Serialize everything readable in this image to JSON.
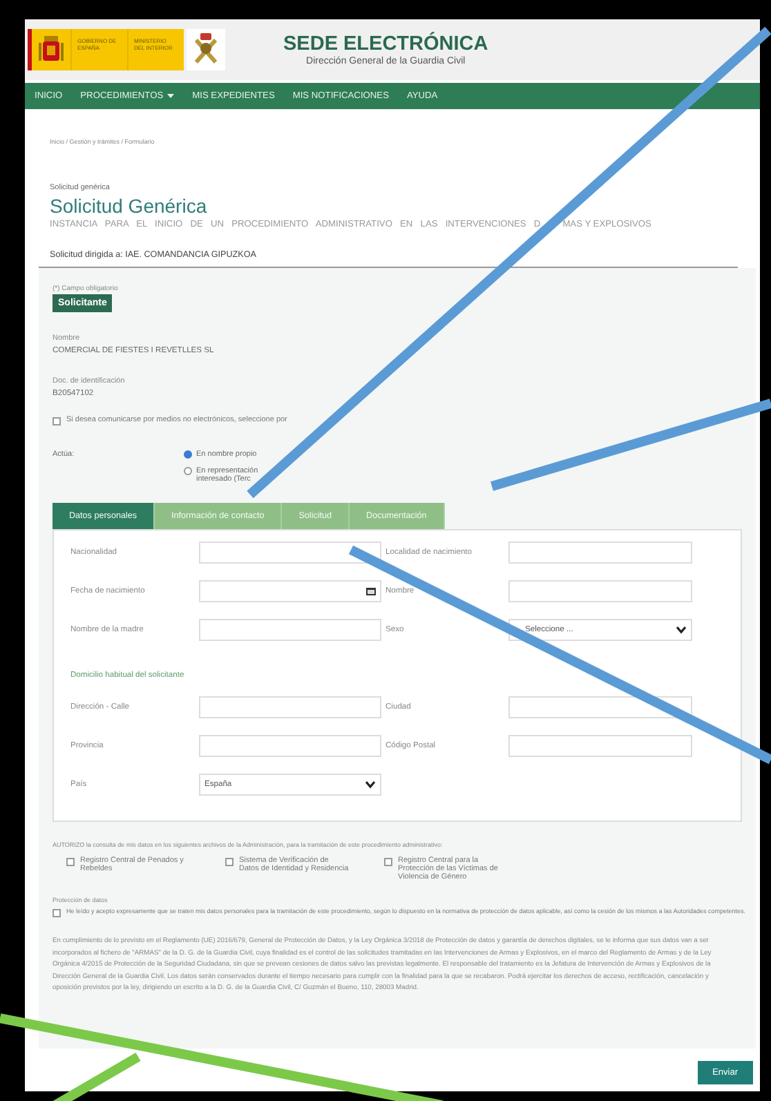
{
  "header": {
    "logo_lines": [
      "GOBIERNO DE ESPAÑA",
      "MINISTERIO DEL INTERIOR"
    ],
    "title": "SEDE ELECTRÓNICA",
    "subtitle": "Dirección General de la Guardia Civil"
  },
  "nav": [
    {
      "label": "INICIO",
      "dropdown": false
    },
    {
      "label": "PROCEDIMIENTOS",
      "dropdown": true
    },
    {
      "label": "MIS EXPEDIENTES",
      "dropdown": false
    },
    {
      "label": "MIS NOTIFICACIONES",
      "dropdown": false
    },
    {
      "label": "AYUDA",
      "dropdown": false
    }
  ],
  "breadcrumb": "Inicio / Gestión y trámites / Formulario",
  "form": {
    "kicker": "Solicitud genérica",
    "title": "Solicitud Genérica",
    "subtitle": [
      "INSTANCIA PARA EL INICIO DE UN PROCEDIMIENTO ADMINISTRATIVO EN LAS INTERVENCIONES D",
      "MAS Y EXPLOSIVOS"
    ],
    "addressee": "Solicitud dirigida a: IAE. COMANDANCIA GIPUZKOA"
  },
  "applicant": {
    "required_note": "(*) Campo obligatorio",
    "section": "Solicitante",
    "fields": [
      {
        "label": "Nombre",
        "value": "COMERCIAL DE FIESTES I REVETLLES SL"
      },
      {
        "label": "Doc. de identificación",
        "value": "B20547102"
      }
    ],
    "non_electronic": {
      "label": "Si desea comunicarse por medios no electrónicos, seleccione por",
      "checked": false
    },
    "acts_label": "Actúa:",
    "acts_options": [
      {
        "label": "En nombre propio",
        "selected": true
      },
      {
        "label": "En representación\ninteresado (Terc",
        "selected": false
      }
    ]
  },
  "tabs": [
    {
      "label": "Datos personales",
      "selected": true
    },
    {
      "label": "Información de contacto",
      "selected": false
    },
    {
      "label": "Solicitud",
      "selected": false
    },
    {
      "label": "Documentación",
      "selected": false
    }
  ],
  "rows": [
    {
      "kind": "pair",
      "fields": [
        {
          "label": "Nacionalidad",
          "kind": "text"
        },
        {
          "label": "Localidad de nacimiento",
          "kind": "text"
        }
      ]
    },
    {
      "kind": "pair",
      "fields": [
        {
          "label": "Fecha de nacimiento",
          "kind": "date"
        },
        {
          "label": "Nombre",
          "kind": "text"
        }
      ]
    },
    {
      "kind": "pair",
      "fields": [
        {
          "label": "Nombre de la madre",
          "kind": "text"
        },
        {
          "label": "Sexo",
          "kind": "select",
          "value": "Seleccione ..."
        }
      ]
    },
    {
      "kind": "heading",
      "text": "Domicilio habitual del solicitante"
    },
    {
      "kind": "pair",
      "fields": [
        {
          "label": "Dirección - Calle",
          "kind": "text"
        },
        {
          "label": "Ciudad",
          "kind": "text"
        }
      ]
    },
    {
      "kind": "pair",
      "fields": [
        {
          "label": "Provincia",
          "kind": "text"
        },
        {
          "label": "Código Postal",
          "kind": "text"
        }
      ]
    },
    {
      "kind": "pair",
      "fields": [
        {
          "label": "País",
          "kind": "select",
          "value": "España"
        }
      ]
    }
  ],
  "consents": {
    "intro": "AUTORIZO la consulta de mis datos en los siguientes archivos de la Administración, para la tramitación de este procedimiento administrativo:",
    "options": [
      {
        "label": "Registro Central de Penados y Rebeldes",
        "checked": false
      },
      {
        "label": "Sistema de Verificación de Datos de Identidad y Residencia",
        "checked": false
      },
      {
        "label": "Registro Central para la Protección de las Víctimas de Violencia de Género",
        "checked": false
      }
    ],
    "privacy_title": "Protección de datos",
    "privacy": {
      "label": "He leído y acepto expresamente que se traten mis datos personales para la tramitación de este procedimiento, según lo dispuesto en la normativa de protección de datos aplicable, así como la cesión de los mismos a las Autoridades competentes.",
      "checked": false
    },
    "legal": "En cumplimiento de lo previsto en el Reglamento (UE) 2016/679, General de Protección de Datos, y la Ley Orgánica 3/2018 de Protección de datos y garantía de derechos digitales, se le informa que sus datos van a ser incorporados al fichero de \"ARMAS\" de la D. G. de la Guardia Civil, cuya finalidad es el control de las solicitudes tramitadas en las Intervenciones de Armas y Explosivos, en el marco del Reglamento de Armas y de la Ley Orgánica 4/2015 de Protección de la Seguridad Ciudadana, sin que se prevean cesiones de datos salvo las previstas legalmente. El responsable del tratamiento es la Jefatura de Intervención de Armas y Explosivos de la Dirección General de la Guardia Civil. Los datos serán conservados durante el tiempo necesario para cumplir con la finalidad para la que se recabaron. Podrá ejercitar los derechos de acceso, rectificación, cancelación y oposición previstos por la ley, dirigiendo un escrito a la D. G. de la Guardia Civil, C/ Guzmán el Bueno, 110, 28003 Madrid."
  },
  "submit": "Enviar"
}
